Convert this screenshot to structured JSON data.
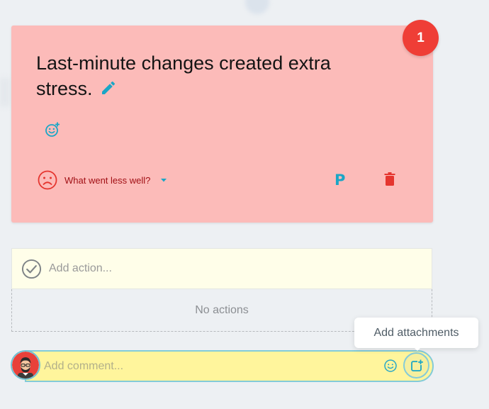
{
  "card": {
    "vote_count": "1",
    "text": "Last-minute changes created extra stress.",
    "category_label": "What went less well?",
    "category_color": "#a10f14",
    "background_color": "#fcbbb9",
    "icons": {
      "edit": "pencil-icon",
      "add_reaction": "add-emoji-icon",
      "category": "sad-face-icon",
      "dropdown": "caret-down-icon",
      "pin": "p-icon",
      "delete": "trash-icon"
    }
  },
  "actions": {
    "placeholder": "Add action...",
    "empty_text": "No actions",
    "icon": "check-circle-icon"
  },
  "comment": {
    "placeholder": "Add comment...",
    "emoji_icon": "smile-icon",
    "attach_icon": "add-attachment-icon",
    "tooltip": "Add attachments",
    "avatar_icon": "user-avatar"
  }
}
